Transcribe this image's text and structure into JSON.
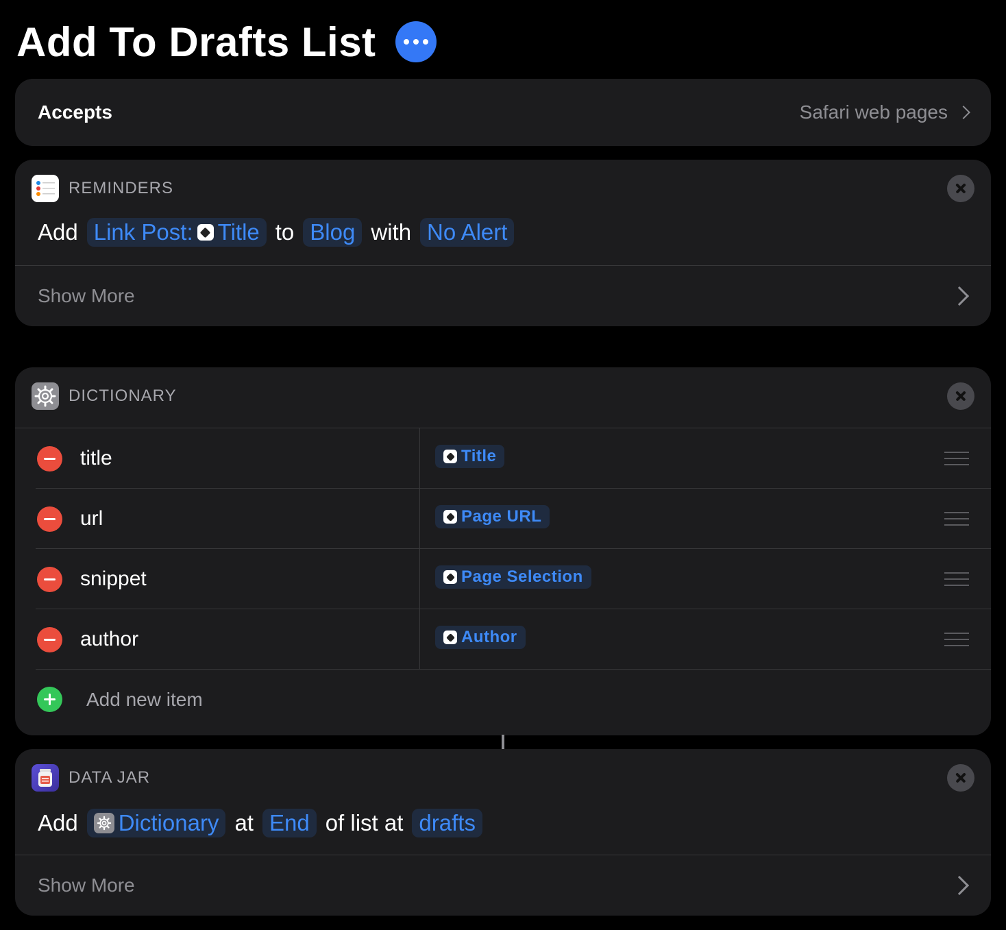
{
  "header": {
    "title": "Add To Drafts List",
    "more_icon": "ellipsis-icon"
  },
  "accepts": {
    "label": "Accepts",
    "value": "Safari web pages"
  },
  "reminders": {
    "app_name": "REMINDERS",
    "words": {
      "add": "Add",
      "to": "to",
      "with": "with"
    },
    "tokens": {
      "link_post": "Link Post:",
      "title_var": "Title",
      "list": "Blog",
      "alert": "No Alert"
    },
    "show_more": "Show More"
  },
  "dictionary": {
    "app_name": "DICTIONARY",
    "items": [
      {
        "key": "title",
        "value": "Title"
      },
      {
        "key": "url",
        "value": "Page URL"
      },
      {
        "key": "snippet",
        "value": "Page Selection"
      },
      {
        "key": "author",
        "value": "Author"
      }
    ],
    "add_new": "Add new item"
  },
  "data_jar": {
    "app_name": "DATA JAR",
    "words": {
      "add": "Add",
      "at": "at",
      "of_list_at": "of list at"
    },
    "tokens": {
      "dictionary": "Dictionary",
      "position": "End",
      "key": "drafts"
    },
    "show_more": "Show More"
  },
  "colors": {
    "accent": "#3478f6",
    "token_text": "#3e8af7",
    "delete": "#eb4d3d",
    "add": "#34c759",
    "card": "#1c1c1e"
  }
}
